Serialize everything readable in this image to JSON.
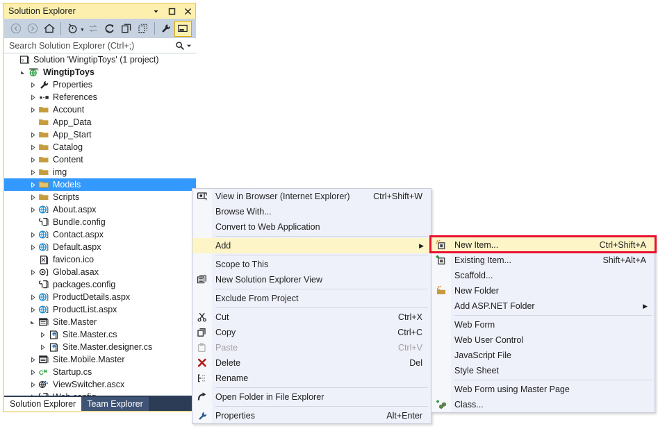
{
  "panel": {
    "title": "Solution Explorer",
    "titlebar_buttons": [
      {
        "name": "dropdown-icon",
        "glyph": "▾"
      },
      {
        "name": "maximize-icon",
        "glyph": "□"
      },
      {
        "name": "close-icon",
        "glyph": "✕"
      }
    ],
    "toolbar": [
      {
        "name": "back-button",
        "tooltip": "Back",
        "disabled": true
      },
      {
        "name": "forward-button",
        "tooltip": "Forward",
        "disabled": true
      },
      {
        "name": "home-button",
        "tooltip": "Home",
        "disabled": false
      },
      {
        "name": "pending-changes-button",
        "tooltip": "Pending Changes Filter",
        "disabled": false
      },
      {
        "name": "sync-with-active-document-button",
        "tooltip": "Sync with Active Document",
        "disabled": true
      },
      {
        "name": "refresh-button",
        "tooltip": "Refresh",
        "disabled": false
      },
      {
        "name": "collapse-all-button",
        "tooltip": "Collapse All",
        "disabled": false
      },
      {
        "name": "show-all-files-button",
        "tooltip": "Show All Files",
        "disabled": false
      },
      {
        "name": "properties-button",
        "tooltip": "Properties",
        "disabled": false
      },
      {
        "name": "preview-selected-items-toggle",
        "tooltip": "Preview Selected Items",
        "disabled": false
      }
    ],
    "search": {
      "placeholder": "Search Solution Explorer (Ctrl+;)",
      "value": ""
    },
    "tabs": [
      {
        "label": "Solution Explorer",
        "active": true
      },
      {
        "label": "Team Explorer",
        "active": false
      }
    ]
  },
  "tree": [
    {
      "label": "Solution 'WingtipToys' (1 project)",
      "indent": 0,
      "arrow": "none",
      "icon": "solution-icon",
      "bold": false,
      "selected": false
    },
    {
      "label": "WingtipToys",
      "indent": 1,
      "arrow": "expanded",
      "icon": "web-project-icon",
      "bold": true,
      "selected": false
    },
    {
      "label": "Properties",
      "indent": 2,
      "arrow": "collapsed",
      "icon": "wrench-icon",
      "bold": false,
      "selected": false
    },
    {
      "label": "References",
      "indent": 2,
      "arrow": "collapsed",
      "icon": "references-icon",
      "bold": false,
      "selected": false
    },
    {
      "label": "Account",
      "indent": 2,
      "arrow": "collapsed",
      "icon": "folder-icon",
      "bold": false,
      "selected": false
    },
    {
      "label": "App_Data",
      "indent": 2,
      "arrow": "none",
      "icon": "folder-icon",
      "bold": false,
      "selected": false
    },
    {
      "label": "App_Start",
      "indent": 2,
      "arrow": "collapsed",
      "icon": "folder-icon",
      "bold": false,
      "selected": false
    },
    {
      "label": "Catalog",
      "indent": 2,
      "arrow": "collapsed",
      "icon": "folder-icon",
      "bold": false,
      "selected": false
    },
    {
      "label": "Content",
      "indent": 2,
      "arrow": "collapsed",
      "icon": "folder-icon",
      "bold": false,
      "selected": false
    },
    {
      "label": "img",
      "indent": 2,
      "arrow": "collapsed",
      "icon": "folder-icon",
      "bold": false,
      "selected": false
    },
    {
      "label": "Models",
      "indent": 2,
      "arrow": "collapsed",
      "icon": "folder-open-icon",
      "bold": false,
      "selected": true
    },
    {
      "label": "Scripts",
      "indent": 2,
      "arrow": "collapsed",
      "icon": "folder-icon",
      "bold": false,
      "selected": false
    },
    {
      "label": "About.aspx",
      "indent": 2,
      "arrow": "collapsed",
      "icon": "aspx-icon",
      "bold": false,
      "selected": false
    },
    {
      "label": "Bundle.config",
      "indent": 2,
      "arrow": "none",
      "icon": "config-icon",
      "bold": false,
      "selected": false
    },
    {
      "label": "Contact.aspx",
      "indent": 2,
      "arrow": "collapsed",
      "icon": "aspx-icon",
      "bold": false,
      "selected": false
    },
    {
      "label": "Default.aspx",
      "indent": 2,
      "arrow": "collapsed",
      "icon": "aspx-icon",
      "bold": false,
      "selected": false
    },
    {
      "label": "favicon.ico",
      "indent": 2,
      "arrow": "none",
      "icon": "image-file-icon",
      "bold": false,
      "selected": false
    },
    {
      "label": "Global.asax",
      "indent": 2,
      "arrow": "collapsed",
      "icon": "asax-icon",
      "bold": false,
      "selected": false
    },
    {
      "label": "packages.config",
      "indent": 2,
      "arrow": "none",
      "icon": "config-icon",
      "bold": false,
      "selected": false
    },
    {
      "label": "ProductDetails.aspx",
      "indent": 2,
      "arrow": "collapsed",
      "icon": "aspx-icon",
      "bold": false,
      "selected": false
    },
    {
      "label": "ProductList.aspx",
      "indent": 2,
      "arrow": "collapsed",
      "icon": "aspx-icon",
      "bold": false,
      "selected": false
    },
    {
      "label": "Site.Master",
      "indent": 2,
      "arrow": "expanded",
      "icon": "master-page-icon",
      "bold": false,
      "selected": false
    },
    {
      "label": "Site.Master.cs",
      "indent": 3,
      "arrow": "collapsed",
      "icon": "code-behind-icon",
      "bold": false,
      "selected": false
    },
    {
      "label": "Site.Master.designer.cs",
      "indent": 3,
      "arrow": "collapsed",
      "icon": "code-behind-icon",
      "bold": false,
      "selected": false
    },
    {
      "label": "Site.Mobile.Master",
      "indent": 2,
      "arrow": "collapsed",
      "icon": "master-page-icon",
      "bold": false,
      "selected": false
    },
    {
      "label": "Startup.cs",
      "indent": 2,
      "arrow": "collapsed",
      "icon": "csharp-icon",
      "bold": false,
      "selected": false
    },
    {
      "label": "ViewSwitcher.ascx",
      "indent": 2,
      "arrow": "collapsed",
      "icon": "ascx-icon",
      "bold": false,
      "selected": false
    },
    {
      "label": "Web.config",
      "indent": 2,
      "arrow": "collapsed",
      "icon": "config-icon",
      "bold": false,
      "selected": false
    }
  ],
  "context_menu": [
    {
      "type": "item",
      "label": "View in Browser (Internet Explorer)",
      "shortcut": "Ctrl+Shift+W",
      "icon": "view-in-browser-icon",
      "highlighted": false,
      "disabled": false,
      "submenu": false
    },
    {
      "type": "item",
      "label": "Browse With...",
      "shortcut": "",
      "icon": "",
      "highlighted": false,
      "disabled": false,
      "submenu": false
    },
    {
      "type": "item",
      "label": "Convert to Web Application",
      "shortcut": "",
      "icon": "",
      "highlighted": false,
      "disabled": false,
      "submenu": false
    },
    {
      "type": "separator"
    },
    {
      "type": "item",
      "label": "Add",
      "shortcut": "",
      "icon": "",
      "highlighted": true,
      "disabled": false,
      "submenu": true
    },
    {
      "type": "separator"
    },
    {
      "type": "item",
      "label": "Scope to This",
      "shortcut": "",
      "icon": "",
      "highlighted": false,
      "disabled": false,
      "submenu": false
    },
    {
      "type": "item",
      "label": "New Solution Explorer View",
      "shortcut": "",
      "icon": "new-solution-view-icon",
      "highlighted": false,
      "disabled": false,
      "submenu": false
    },
    {
      "type": "separator"
    },
    {
      "type": "item",
      "label": "Exclude From Project",
      "shortcut": "",
      "icon": "",
      "highlighted": false,
      "disabled": false,
      "submenu": false
    },
    {
      "type": "separator"
    },
    {
      "type": "item",
      "label": "Cut",
      "shortcut": "Ctrl+X",
      "icon": "scissors-icon",
      "highlighted": false,
      "disabled": false,
      "submenu": false
    },
    {
      "type": "item",
      "label": "Copy",
      "shortcut": "Ctrl+C",
      "icon": "copy-icon",
      "highlighted": false,
      "disabled": false,
      "submenu": false
    },
    {
      "type": "item",
      "label": "Paste",
      "shortcut": "Ctrl+V",
      "icon": "paste-icon",
      "highlighted": false,
      "disabled": true,
      "submenu": false
    },
    {
      "type": "item",
      "label": "Delete",
      "shortcut": "Del",
      "icon": "delete-x-icon",
      "highlighted": false,
      "disabled": false,
      "submenu": false
    },
    {
      "type": "item",
      "label": "Rename",
      "shortcut": "",
      "icon": "rename-icon",
      "highlighted": false,
      "disabled": false,
      "submenu": false
    },
    {
      "type": "separator"
    },
    {
      "type": "item",
      "label": "Open Folder in File Explorer",
      "shortcut": "",
      "icon": "open-folder-arrow-icon",
      "highlighted": false,
      "disabled": false,
      "submenu": false
    },
    {
      "type": "separator"
    },
    {
      "type": "item",
      "label": "Properties",
      "shortcut": "Alt+Enter",
      "icon": "wrench-icon",
      "highlighted": false,
      "disabled": false,
      "submenu": false
    }
  ],
  "submenu": [
    {
      "type": "item",
      "label": "New Item...",
      "shortcut": "Ctrl+Shift+A",
      "icon": "new-item-icon",
      "highlighted": true,
      "submenu": false
    },
    {
      "type": "item",
      "label": "Existing Item...",
      "shortcut": "Shift+Alt+A",
      "icon": "existing-item-icon",
      "highlighted": false,
      "submenu": false
    },
    {
      "type": "item",
      "label": "Scaffold...",
      "shortcut": "",
      "icon": "",
      "highlighted": false,
      "submenu": false
    },
    {
      "type": "item",
      "label": "New Folder",
      "shortcut": "",
      "icon": "new-folder-icon",
      "highlighted": false,
      "submenu": false
    },
    {
      "type": "item",
      "label": "Add ASP.NET Folder",
      "shortcut": "",
      "icon": "",
      "highlighted": false,
      "submenu": true
    },
    {
      "type": "separator"
    },
    {
      "type": "item",
      "label": "Web Form",
      "shortcut": "",
      "icon": "",
      "highlighted": false,
      "submenu": false
    },
    {
      "type": "item",
      "label": "Web User Control",
      "shortcut": "",
      "icon": "",
      "highlighted": false,
      "submenu": false
    },
    {
      "type": "item",
      "label": "JavaScript File",
      "shortcut": "",
      "icon": "",
      "highlighted": false,
      "submenu": false
    },
    {
      "type": "item",
      "label": "Style Sheet",
      "shortcut": "",
      "icon": "",
      "highlighted": false,
      "submenu": false
    },
    {
      "type": "separator"
    },
    {
      "type": "item",
      "label": "Web Form using Master Page",
      "shortcut": "",
      "icon": "",
      "highlighted": false,
      "submenu": false
    },
    {
      "type": "item",
      "label": "Class...",
      "shortcut": "",
      "icon": "class-icon",
      "highlighted": false,
      "submenu": false
    }
  ],
  "annotation": {
    "name": "red-highlight-box",
    "color": "#e8112d",
    "target": "New Item..."
  },
  "colors": {
    "titlebar": "#fdf0ae",
    "panel_border": "#e5c365",
    "toolbar": "#c6d2e0",
    "selection_blue": "#3399ff",
    "menu_bg": "#eef1f9",
    "menu_highlight": "#fdf4c8",
    "tab_strip": "#2d3c56",
    "annotation_red": "#e8112d"
  }
}
